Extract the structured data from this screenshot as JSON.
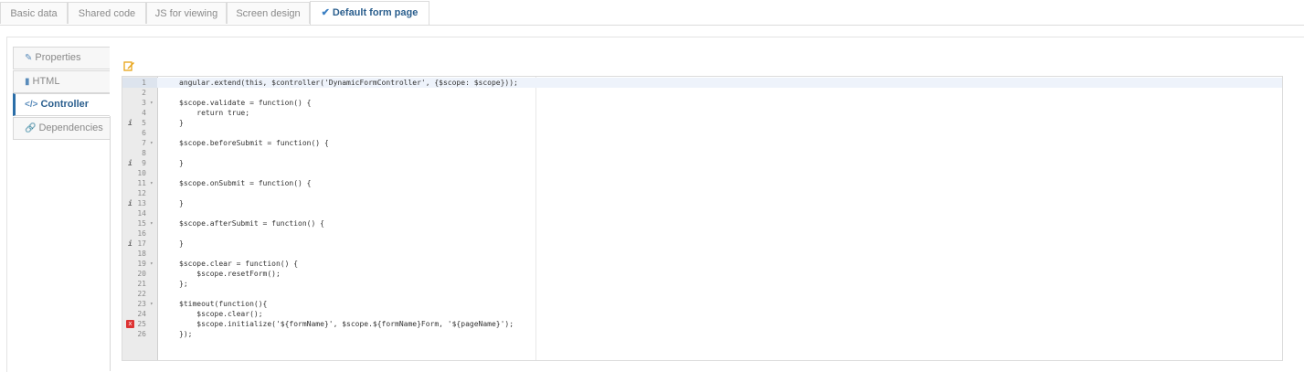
{
  "top_tabs": [
    {
      "label": "Basic data"
    },
    {
      "label": "Shared code"
    },
    {
      "label": "JS for viewing"
    },
    {
      "label": "Screen design"
    },
    {
      "label": "Default form page"
    }
  ],
  "side_tabs": [
    {
      "label": "Properties",
      "icon": "edit-icon"
    },
    {
      "label": "HTML",
      "icon": "file-icon"
    },
    {
      "label": "Controller",
      "icon": "code-icon"
    },
    {
      "label": "Dependencies",
      "icon": "link-icon"
    }
  ],
  "editor": {
    "lines": [
      {
        "n": "1"
      },
      {
        "n": "2"
      },
      {
        "n": "3"
      },
      {
        "n": "4"
      },
      {
        "n": "5"
      },
      {
        "n": "6"
      },
      {
        "n": "7"
      },
      {
        "n": "8"
      },
      {
        "n": "9"
      },
      {
        "n": "10"
      },
      {
        "n": "11"
      },
      {
        "n": "12"
      },
      {
        "n": "13"
      },
      {
        "n": "14"
      },
      {
        "n": "15"
      },
      {
        "n": "16"
      },
      {
        "n": "17"
      },
      {
        "n": "18"
      },
      {
        "n": "19"
      },
      {
        "n": "20"
      },
      {
        "n": "21"
      },
      {
        "n": "22"
      },
      {
        "n": "23"
      },
      {
        "n": "24"
      },
      {
        "n": "25"
      },
      {
        "n": "26"
      }
    ],
    "code": [
      "angular.extend(this, $controller('DynamicFormController', {$scope: $scope}));",
      "",
      "$scope.validate = function() {",
      "    return true;",
      "}",
      "",
      "$scope.beforeSubmit = function() {",
      "",
      "}",
      "",
      "$scope.onSubmit = function() {",
      "",
      "}",
      "",
      "$scope.afterSubmit = function() {",
      "",
      "}",
      "",
      "$scope.clear = function() {",
      "    $scope.resetForm();",
      "};",
      "",
      "$timeout(function(){",
      "    $scope.clear();",
      "    $scope.initialize('${formName}', $scope.${formName}Form, '${pageName}');",
      "});"
    ],
    "info_marker": "i",
    "error_marker": "x",
    "fold_marker": "▾"
  },
  "colors": {
    "active_tab_text": "#2b5f8e",
    "check": "#3a7fc3",
    "edit_icon": "#e8a317",
    "error": "#dd3333"
  }
}
